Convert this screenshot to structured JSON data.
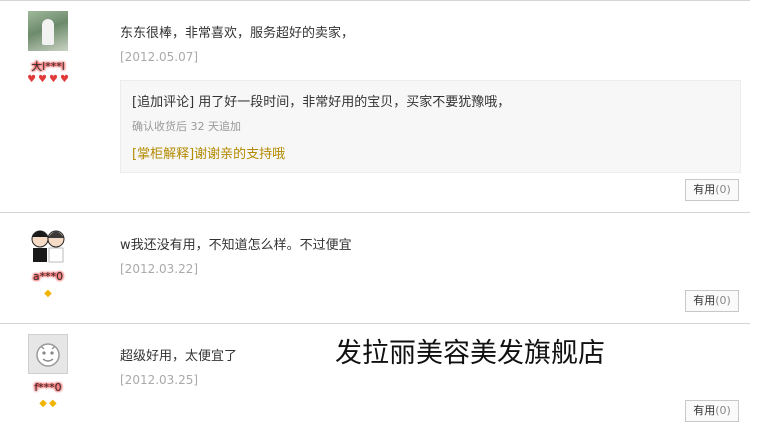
{
  "reviews": [
    {
      "nickname": "大l***l",
      "badge_type": "heart",
      "badge_count": 4,
      "text": "东东很棒，非常喜欢，服务超好的卖家，",
      "date": "[2012.05.07]",
      "append": {
        "text": "[追加评论] 用了好一段时间，非常好用的宝贝，买家不要犹豫哦，",
        "meta": "确认收货后 32 天追加",
        "reply": "[掌柜解释]谢谢亲的支持哦"
      },
      "useful_label": "有用",
      "useful_count": "(0)"
    },
    {
      "nickname": "a***0",
      "badge_type": "diamond",
      "badge_count": 1,
      "text": "w我还没有用，不知道怎么样。不过便宜",
      "date": "[2012.03.22]",
      "useful_label": "有用",
      "useful_count": "(0)"
    },
    {
      "nickname": "f***0",
      "badge_type": "diamond",
      "badge_count": 2,
      "text": "超级好用，太便宜了",
      "date": "[2012.03.25]",
      "useful_label": "有用",
      "useful_count": "(0)"
    }
  ],
  "watermark": "发拉丽美容美发旗舰店",
  "colors": {
    "heart": "#e13a3a",
    "diamond": "#f0b400",
    "reply": "#b38a00"
  }
}
